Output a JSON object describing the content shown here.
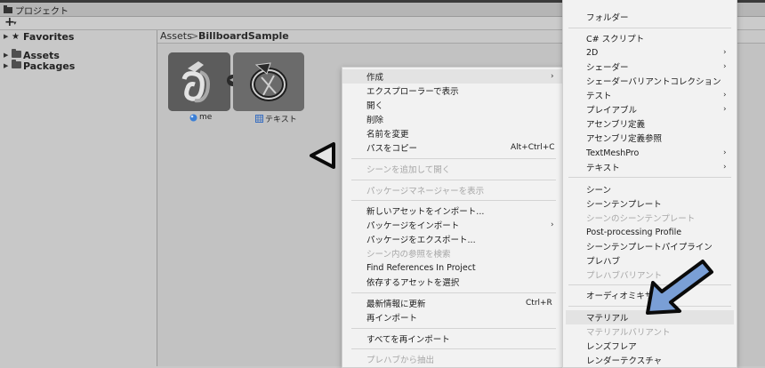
{
  "window": {
    "title": "プロジェクト"
  },
  "toolbar": {
    "add_label": "+",
    "add_caret": "▾"
  },
  "tree": [
    {
      "label": "Favorites",
      "icon": "star-icon"
    },
    {
      "label": "Assets",
      "icon": "folder-icon"
    },
    {
      "label": "Packages",
      "icon": "folder-icon"
    }
  ],
  "breadcrumb": {
    "root": "Assets",
    "separator": ">",
    "current": "BillboardSample"
  },
  "assets": [
    {
      "label": "me",
      "icon": "material-sphere-icon"
    },
    {
      "label": "テキスト",
      "icon": "texture-grid-icon"
    }
  ],
  "context_menu": {
    "items": [
      {
        "label": "作成",
        "submenu": true
      },
      {
        "label": "エクスプローラーで表示"
      },
      {
        "label": "開く"
      },
      {
        "label": "削除"
      },
      {
        "label": "名前を変更"
      },
      {
        "label": "パスをコピー",
        "shortcut": "Alt+Ctrl+C"
      },
      {
        "label": "シーンを追加して開く",
        "disabled": true
      },
      {
        "label": "パッケージマネージャーを表示",
        "disabled": true
      },
      {
        "label": "新しいアセットをインポート..."
      },
      {
        "label": "パッケージをインポート",
        "submenu": true
      },
      {
        "label": "パッケージをエクスポート..."
      },
      {
        "label": "シーン内の参照を検索",
        "disabled": true
      },
      {
        "label": "Find References In Project"
      },
      {
        "label": "依存するアセットを選択"
      },
      {
        "label": "最新情報に更新",
        "shortcut": "Ctrl+R"
      },
      {
        "label": "再インポート"
      },
      {
        "label": "すべてを再インポート"
      },
      {
        "label": "プレハブから抽出",
        "disabled": true
      }
    ]
  },
  "create_submenu": {
    "items": [
      {
        "label": "フォルダー"
      },
      {
        "label": "C# スクリプト"
      },
      {
        "label": "2D",
        "submenu": true
      },
      {
        "label": "シェーダー",
        "submenu": true
      },
      {
        "label": "シェーダーバリアントコレクション"
      },
      {
        "label": "テスト",
        "submenu": true
      },
      {
        "label": "プレイアブル",
        "submenu": true
      },
      {
        "label": "アセンブリ定義"
      },
      {
        "label": "アセンブリ定義参照"
      },
      {
        "label": "TextMeshPro",
        "submenu": true
      },
      {
        "label": "テキスト",
        "submenu": true
      },
      {
        "label": "シーン"
      },
      {
        "label": "シーンテンプレート"
      },
      {
        "label": "シーンのシーンテンプレート",
        "disabled": true
      },
      {
        "label": "Post-processing Profile"
      },
      {
        "label": "シーンテンプレートパイプライン"
      },
      {
        "label": "プレハブ"
      },
      {
        "label": "プレハブバリアント",
        "disabled": true
      },
      {
        "label": "オーディオミキサー"
      },
      {
        "label": "マテリアル",
        "highlighted": true
      },
      {
        "label": "マテリアルバリアント",
        "disabled": true
      },
      {
        "label": "レンズフレア"
      },
      {
        "label": "レンダーテクスチャ"
      }
    ]
  },
  "colors": {
    "menu_bg": "#f2f2f2",
    "annotation_arrow": "#7a9fd6",
    "annotation_outline": "#0a0a0a"
  }
}
